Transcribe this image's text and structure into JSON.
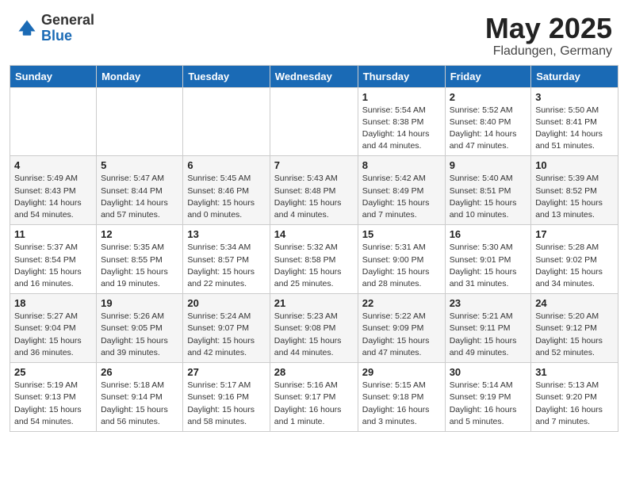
{
  "header": {
    "logo_general": "General",
    "logo_blue": "Blue",
    "month": "May 2025",
    "location": "Fladungen, Germany"
  },
  "days_of_week": [
    "Sunday",
    "Monday",
    "Tuesday",
    "Wednesday",
    "Thursday",
    "Friday",
    "Saturday"
  ],
  "weeks": [
    [
      {
        "day": "",
        "info": ""
      },
      {
        "day": "",
        "info": ""
      },
      {
        "day": "",
        "info": ""
      },
      {
        "day": "",
        "info": ""
      },
      {
        "day": "1",
        "info": "Sunrise: 5:54 AM\nSunset: 8:38 PM\nDaylight: 14 hours\nand 44 minutes."
      },
      {
        "day": "2",
        "info": "Sunrise: 5:52 AM\nSunset: 8:40 PM\nDaylight: 14 hours\nand 47 minutes."
      },
      {
        "day": "3",
        "info": "Sunrise: 5:50 AM\nSunset: 8:41 PM\nDaylight: 14 hours\nand 51 minutes."
      }
    ],
    [
      {
        "day": "4",
        "info": "Sunrise: 5:49 AM\nSunset: 8:43 PM\nDaylight: 14 hours\nand 54 minutes."
      },
      {
        "day": "5",
        "info": "Sunrise: 5:47 AM\nSunset: 8:44 PM\nDaylight: 14 hours\nand 57 minutes."
      },
      {
        "day": "6",
        "info": "Sunrise: 5:45 AM\nSunset: 8:46 PM\nDaylight: 15 hours\nand 0 minutes."
      },
      {
        "day": "7",
        "info": "Sunrise: 5:43 AM\nSunset: 8:48 PM\nDaylight: 15 hours\nand 4 minutes."
      },
      {
        "day": "8",
        "info": "Sunrise: 5:42 AM\nSunset: 8:49 PM\nDaylight: 15 hours\nand 7 minutes."
      },
      {
        "day": "9",
        "info": "Sunrise: 5:40 AM\nSunset: 8:51 PM\nDaylight: 15 hours\nand 10 minutes."
      },
      {
        "day": "10",
        "info": "Sunrise: 5:39 AM\nSunset: 8:52 PM\nDaylight: 15 hours\nand 13 minutes."
      }
    ],
    [
      {
        "day": "11",
        "info": "Sunrise: 5:37 AM\nSunset: 8:54 PM\nDaylight: 15 hours\nand 16 minutes."
      },
      {
        "day": "12",
        "info": "Sunrise: 5:35 AM\nSunset: 8:55 PM\nDaylight: 15 hours\nand 19 minutes."
      },
      {
        "day": "13",
        "info": "Sunrise: 5:34 AM\nSunset: 8:57 PM\nDaylight: 15 hours\nand 22 minutes."
      },
      {
        "day": "14",
        "info": "Sunrise: 5:32 AM\nSunset: 8:58 PM\nDaylight: 15 hours\nand 25 minutes."
      },
      {
        "day": "15",
        "info": "Sunrise: 5:31 AM\nSunset: 9:00 PM\nDaylight: 15 hours\nand 28 minutes."
      },
      {
        "day": "16",
        "info": "Sunrise: 5:30 AM\nSunset: 9:01 PM\nDaylight: 15 hours\nand 31 minutes."
      },
      {
        "day": "17",
        "info": "Sunrise: 5:28 AM\nSunset: 9:02 PM\nDaylight: 15 hours\nand 34 minutes."
      }
    ],
    [
      {
        "day": "18",
        "info": "Sunrise: 5:27 AM\nSunset: 9:04 PM\nDaylight: 15 hours\nand 36 minutes."
      },
      {
        "day": "19",
        "info": "Sunrise: 5:26 AM\nSunset: 9:05 PM\nDaylight: 15 hours\nand 39 minutes."
      },
      {
        "day": "20",
        "info": "Sunrise: 5:24 AM\nSunset: 9:07 PM\nDaylight: 15 hours\nand 42 minutes."
      },
      {
        "day": "21",
        "info": "Sunrise: 5:23 AM\nSunset: 9:08 PM\nDaylight: 15 hours\nand 44 minutes."
      },
      {
        "day": "22",
        "info": "Sunrise: 5:22 AM\nSunset: 9:09 PM\nDaylight: 15 hours\nand 47 minutes."
      },
      {
        "day": "23",
        "info": "Sunrise: 5:21 AM\nSunset: 9:11 PM\nDaylight: 15 hours\nand 49 minutes."
      },
      {
        "day": "24",
        "info": "Sunrise: 5:20 AM\nSunset: 9:12 PM\nDaylight: 15 hours\nand 52 minutes."
      }
    ],
    [
      {
        "day": "25",
        "info": "Sunrise: 5:19 AM\nSunset: 9:13 PM\nDaylight: 15 hours\nand 54 minutes."
      },
      {
        "day": "26",
        "info": "Sunrise: 5:18 AM\nSunset: 9:14 PM\nDaylight: 15 hours\nand 56 minutes."
      },
      {
        "day": "27",
        "info": "Sunrise: 5:17 AM\nSunset: 9:16 PM\nDaylight: 15 hours\nand 58 minutes."
      },
      {
        "day": "28",
        "info": "Sunrise: 5:16 AM\nSunset: 9:17 PM\nDaylight: 16 hours\nand 1 minute."
      },
      {
        "day": "29",
        "info": "Sunrise: 5:15 AM\nSunset: 9:18 PM\nDaylight: 16 hours\nand 3 minutes."
      },
      {
        "day": "30",
        "info": "Sunrise: 5:14 AM\nSunset: 9:19 PM\nDaylight: 16 hours\nand 5 minutes."
      },
      {
        "day": "31",
        "info": "Sunrise: 5:13 AM\nSunset: 9:20 PM\nDaylight: 16 hours\nand 7 minutes."
      }
    ]
  ]
}
